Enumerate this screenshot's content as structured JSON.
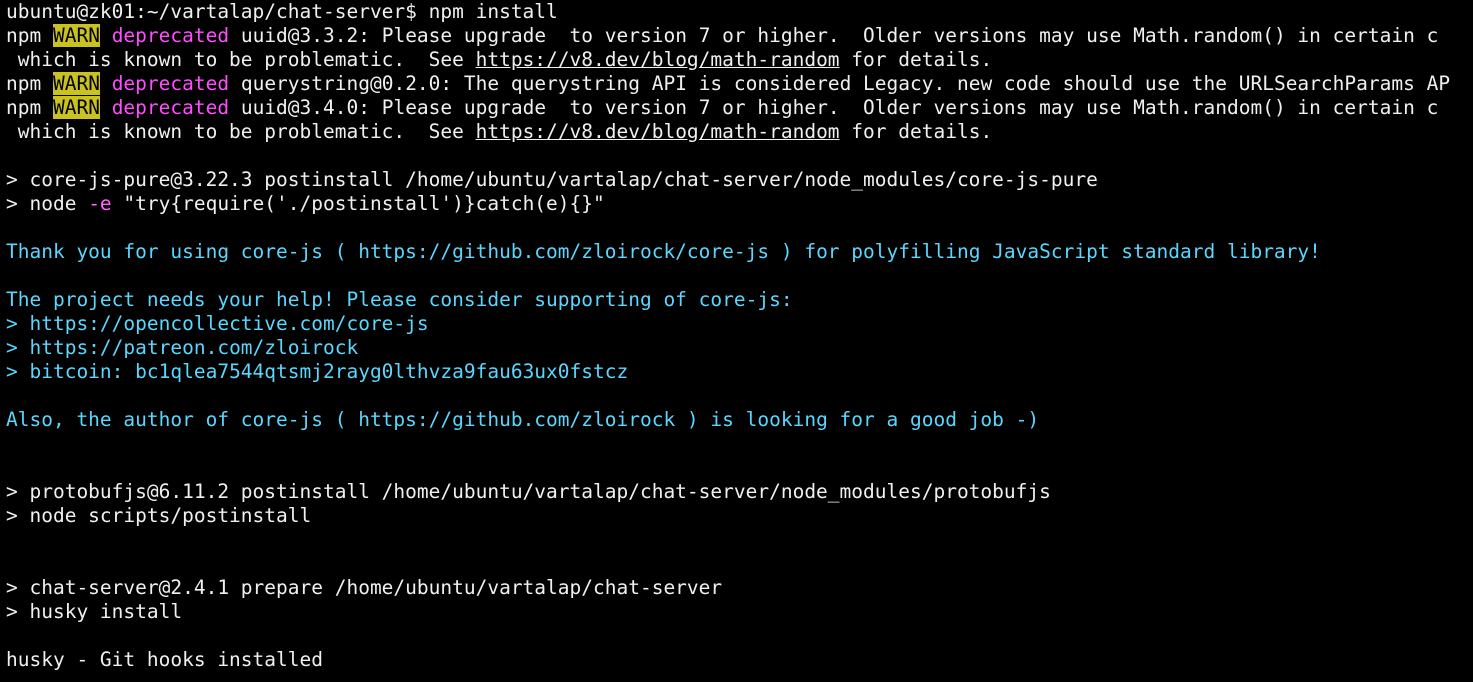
{
  "terminal": {
    "prompt": "ubuntu@zk01:~/vartalap/chat-server$ npm install",
    "warn1": {
      "prefix": "npm ",
      "warn": "WARN",
      "sp": " ",
      "deprecated": "deprecated",
      "rest": " uuid@3.3.2: Please upgrade  to version 7 or higher.  Older versions may use Math.random() in certain c",
      "cont_a": " which is known to be problematic.  See ",
      "link": "https://v8.dev/blog/math-random",
      "cont_b": " for details."
    },
    "warn2": {
      "prefix": "npm ",
      "warn": "WARN",
      "sp": " ",
      "deprecated": "deprecated",
      "rest": " querystring@0.2.0: The querystring API is considered Legacy. new code should use the URLSearchParams AP"
    },
    "warn3": {
      "prefix": "npm ",
      "warn": "WARN",
      "sp": " ",
      "deprecated": "deprecated",
      "rest": " uuid@3.4.0: Please upgrade  to version 7 or higher.  Older versions may use Math.random() in certain c",
      "cont_a": " which is known to be problematic.  See ",
      "link": "https://v8.dev/blog/math-random",
      "cont_b": " for details."
    },
    "corejs_postinstall": "> core-js-pure@3.22.3 postinstall /home/ubuntu/vartalap/chat-server/node_modules/core-js-pure",
    "corejs_node_a": "> node ",
    "corejs_node_flag": "-e",
    "corejs_node_b": " \"try{require('./postinstall')}catch(e){}\"",
    "thanks_a": "Thank you for using core-js ( ",
    "thanks_url": "https://github.com/zloirock/core-js",
    "thanks_b": " ) for polyfilling JavaScript standard library!",
    "help": "The project needs your help! Please consider supporting of core-js:",
    "support1_gt": "> ",
    "support1": "https://opencollective.com/core-js",
    "support2_gt": "> ",
    "support2": "https://patreon.com/zloirock",
    "support3_gt": "> ",
    "support3": "bitcoin: bc1qlea7544qtsmj2rayg0lthvza9fau63ux0fstcz",
    "also_a": "Also, the author of core-js ( ",
    "also_url": "https://github.com/zloirock",
    "also_b": " ) is looking for a good job -)",
    "protobuf_postinstall": "> protobufjs@6.11.2 postinstall /home/ubuntu/vartalap/chat-server/node_modules/protobufjs",
    "protobuf_node": "> node scripts/postinstall",
    "chat_prepare": "> chat-server@2.4.1 prepare /home/ubuntu/vartalap/chat-server",
    "husky_install": "> husky install",
    "husky_done": "husky - Git hooks installed"
  },
  "colors": {
    "background": "#000000",
    "text": "#f0f0f0",
    "warn_bg": "#c9c221",
    "deprecated": "#ff4dff",
    "cyan": "#5ad7ff"
  }
}
